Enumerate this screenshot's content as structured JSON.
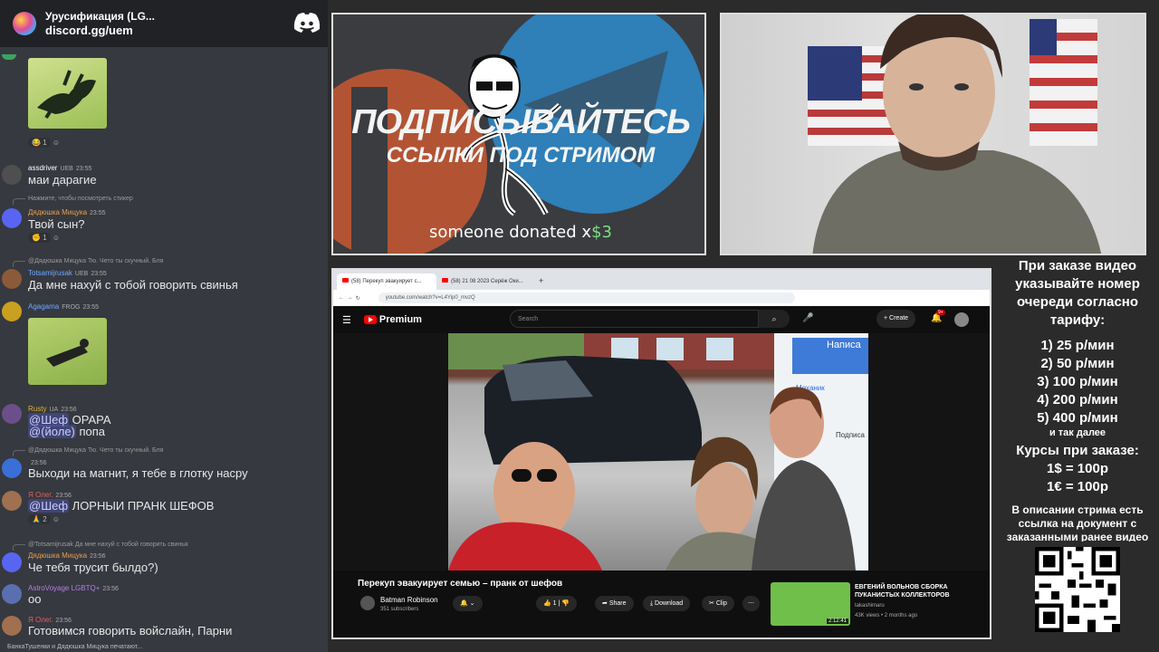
{
  "chat": {
    "server_name": "Урусификация (LG...",
    "invite": "discord.gg/uem",
    "messages": [
      {
        "reaction": "1"
      },
      {
        "author": "assdriver",
        "tag": "UEB",
        "time": "23:55",
        "text": "маи дарагие"
      },
      {
        "reply": "Нажмите, чтобы посмотреть стикер",
        "author": "Дядюшка Мицука",
        "time": "23:55",
        "text": "Твой сын?",
        "reaction": "1"
      },
      {
        "reply": "@Дядюшка Мицука Тю. Чето ты скучный. Бля",
        "author": "Totsamijrusak",
        "tag": "UEB",
        "time": "23:55",
        "text": "Да мне нахуй с тобой говорить свинья"
      },
      {
        "author": "Agagama",
        "tag": "FROG",
        "time": "23:55"
      },
      {
        "author": "Rusty",
        "tag": "UA",
        "time": "23:56",
        "mention1": "@Шеф",
        "text1": " OPAPA",
        "mention2": "@(йоле)",
        "text2": " попа"
      },
      {
        "reply": "@Дядюшка Мицука Тю. Чето ты скучный. Бля",
        "time": "23:56",
        "text": "Выходи на магнит, я тебе в глотку насру"
      },
      {
        "author": "Я Олег.",
        "time": "23:56",
        "mention": "@Шеф",
        "text": " ЛОРНЫИ ПРАНК ШЕФОВ",
        "reaction": "2"
      },
      {
        "reply": "@Totsamijrusak Да мне нахуй с тобой говорить свинья",
        "author": "Дядюшка Мицука",
        "time": "23:56",
        "text": "Че тебя трусит былдо?)"
      },
      {
        "author": "AstroVoyage LGBTQ+",
        "time": "23:56",
        "text": "оо"
      },
      {
        "author": "Я Олег.",
        "time": "23:56",
        "text": "Готовимся говорить войслайн, Парни"
      }
    ],
    "typing": "БанкаТушенки и Дядюшка Мицука печатают..."
  },
  "promo": {
    "title": "ПОДПИСЫВАЙТЕСЬ",
    "subtitle": "ССЫЛКИ ПОД СТРИМОМ",
    "donation_prefix": "someone donated x",
    "donation_amount": "$3"
  },
  "browser": {
    "tab1": "(58) Перекуп эвакуирует с...",
    "tab2": "(58) 21 08 2023 Серёж Оки...",
    "url": "youtube.com/watch?v=L4Yip0_mvzQ",
    "yt_logo": "Premium",
    "search_placeholder": "Search",
    "create_label": "Create",
    "notif_count": "9+",
    "video_title": "Перекуп эвакуирует семью – пранк от шефов",
    "channel": "Batman Robinson",
    "subs": "351 subscribers",
    "likes": "1",
    "share": "Share",
    "download": "Download",
    "clip": "Clip",
    "rec_title": "ЕВГЕНИЙ ВОЛЬНОВ СБОРКА ПУКАНИСТЫХ КОЛЛЕКТОРОВ",
    "rec_channel": "takashimaru",
    "rec_meta": "43K views • 2 months ago",
    "rec_duration": "2:12:41",
    "overlay_text_1": "Написа",
    "overlay_text_2": "Механик",
    "overlay_text_3": "Подписа"
  },
  "info": {
    "heading": "При заказе видео указывайте номер очереди согласно тарифу:",
    "tariffs": [
      "1) 25 р/мин",
      "2) 50 р/мин",
      "3) 100 р/мин",
      "4) 200 р/мин",
      "5) 400 р/мин"
    ],
    "etc": "и так далее",
    "rates_heading": "Курсы при заказе:",
    "rate1": "1$ = 100р",
    "rate2": "1€ = 100р",
    "footer": "В описании стрима есть ссылка на документ с заказанными ранее видео"
  }
}
